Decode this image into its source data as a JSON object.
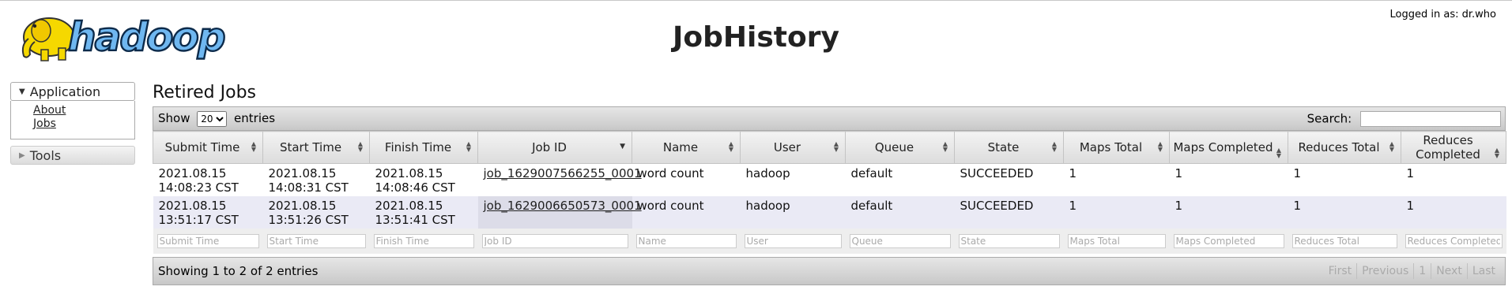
{
  "header": {
    "logo_text": "hadoop",
    "title": "JobHistory",
    "logged_in": "Logged in as: dr.who"
  },
  "nav": {
    "application_label": "Application",
    "links": [
      "About",
      "Jobs"
    ],
    "tools_label": "Tools"
  },
  "main": {
    "section_title": "Retired Jobs",
    "show_label": "Show",
    "entries_label": "entries",
    "page_size": "20",
    "search_label": "Search:",
    "search_value": "",
    "columns": [
      "Submit Time",
      "Start Time",
      "Finish Time",
      "Job ID",
      "Name",
      "User",
      "Queue",
      "State",
      "Maps Total",
      "Maps Completed",
      "Reduces Total",
      "Reduces Completed"
    ],
    "rows": [
      [
        "2021.08.15 14:08:23 CST",
        "2021.08.15 14:08:31 CST",
        "2021.08.15 14:08:46 CST",
        "job_1629007566255_0001",
        "word count",
        "hadoop",
        "default",
        "SUCCEEDED",
        "1",
        "1",
        "1",
        "1"
      ],
      [
        "2021.08.15 13:51:17 CST",
        "2021.08.15 13:51:26 CST",
        "2021.08.15 13:51:41 CST",
        "job_1629006650573_0001",
        "word count",
        "hadoop",
        "default",
        "SUCCEEDED",
        "1",
        "1",
        "1",
        "1"
      ]
    ],
    "filter_placeholders": [
      "Submit Time",
      "Start Time",
      "Finish Time",
      "Job ID",
      "Name",
      "User",
      "Queue",
      "State",
      "Maps Total",
      "Maps Completed",
      "Reduces Total",
      "Reduces Completed"
    ],
    "info": "Showing 1 to 2 of 2 entries",
    "pager": {
      "first": "First",
      "previous": "Previous",
      "page": "1",
      "next": "Next",
      "last": "Last"
    }
  },
  "colors": {
    "accent_blue": "#4a8fd0",
    "elephant_yellow": "#f5d800",
    "row_alt": "#eaeaf5"
  }
}
